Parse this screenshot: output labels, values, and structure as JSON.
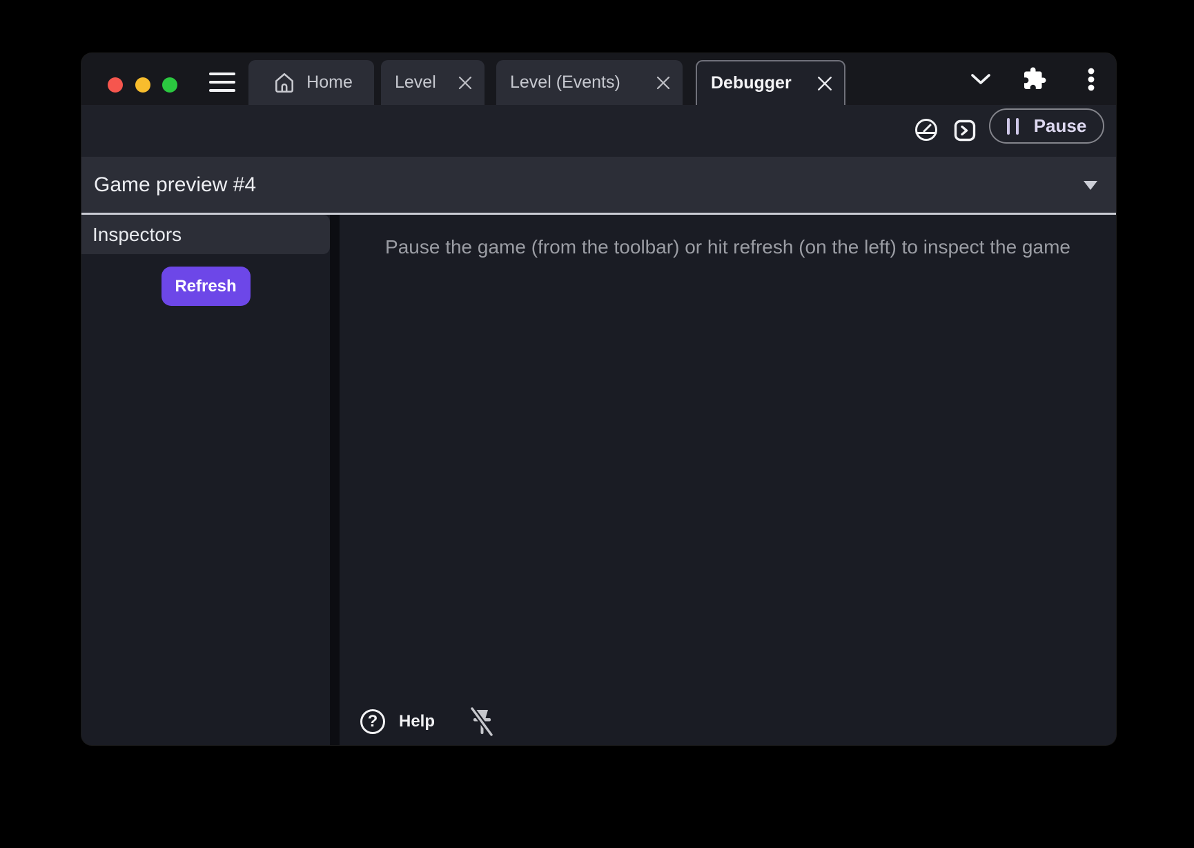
{
  "titlebar": {
    "tabs": [
      {
        "label": "Home",
        "icon": "home-icon",
        "active": false,
        "closable": false
      },
      {
        "label": "Level",
        "active": false,
        "closable": true
      },
      {
        "label": "Level (Events)",
        "active": false,
        "closable": true
      },
      {
        "label": "Debugger",
        "active": true,
        "closable": true
      }
    ],
    "icons": [
      "menu-icon",
      "chevron-down-icon",
      "extensions-puzzle-icon",
      "more-vertical-icon"
    ],
    "window_control_icons": [
      "close-traffic-light",
      "minimize-traffic-light",
      "zoom-traffic-light"
    ]
  },
  "toolbar": {
    "icons": [
      "profiler-gauge-icon",
      "console-icon"
    ],
    "pause_button": {
      "label": "Pause",
      "icon": "pause-icon"
    }
  },
  "preview_bar": {
    "title": "Game preview #4",
    "icon": "dropdown-arrow-icon"
  },
  "sidebar": {
    "header": "Inspectors",
    "refresh_button_label": "Refresh"
  },
  "main": {
    "message": "Pause the game (from the toolbar) or hit refresh (on the left) to inspect the game"
  },
  "footer": {
    "help_icon_glyph": "?",
    "help_label": "Help",
    "icons": [
      "help-circle-icon",
      "pin-off-icon"
    ]
  },
  "colors": {
    "accent": "#6d47e8",
    "window_bg": "#1a1c24",
    "titlebar_bg": "#17181d",
    "inactive_tab_bg": "#2b2d36",
    "toolbar_bg": "#1f2129",
    "preview_bar_bg": "#2c2e37",
    "bright_divider": "#caccd4",
    "message_text": "#9b9da4",
    "traffic_red": "#f6564e",
    "traffic_yellow": "#f8bd2d",
    "traffic_green": "#2bc840"
  }
}
